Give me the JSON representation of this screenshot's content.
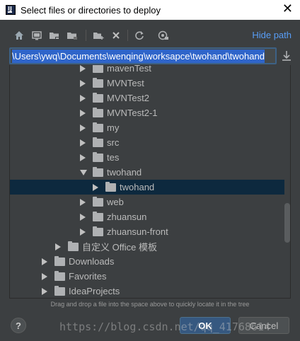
{
  "window": {
    "title": "Select files or directories to deploy",
    "app_icon_letter": "IJ"
  },
  "toolbar": {
    "icons": [
      "home-icon",
      "desktop-icon",
      "project-folder-icon",
      "module-folder-icon",
      "new-folder-icon",
      "delete-icon",
      "refresh-icon",
      "show-hidden-icon"
    ],
    "hide_path_label": "Hide path"
  },
  "path": {
    "value": "\\Users\\ywq\\Documents\\wenqing\\worksapce\\twohand\\twohand"
  },
  "tree": {
    "items": [
      {
        "label": "mavenTest",
        "expanded": false,
        "indent": 2
      },
      {
        "label": "MVNTest",
        "expanded": false,
        "indent": 2
      },
      {
        "label": "MVNTest2",
        "expanded": false,
        "indent": 2
      },
      {
        "label": "MVNTest2-1",
        "expanded": false,
        "indent": 2
      },
      {
        "label": "my",
        "expanded": false,
        "indent": 2
      },
      {
        "label": "src",
        "expanded": false,
        "indent": 2
      },
      {
        "label": "tes",
        "expanded": false,
        "indent": 2
      },
      {
        "label": "twohand",
        "expanded": true,
        "indent": 2
      },
      {
        "label": "twohand",
        "expanded": false,
        "indent": 3,
        "selected": true
      },
      {
        "label": "web",
        "expanded": false,
        "indent": 2
      },
      {
        "label": "zhuansun",
        "expanded": false,
        "indent": 2
      },
      {
        "label": "zhuansun-front",
        "expanded": false,
        "indent": 2
      },
      {
        "label": "自定义 Office 模板",
        "expanded": false,
        "indent": 1
      },
      {
        "label": "Downloads",
        "expanded": false,
        "indent": 0
      },
      {
        "label": "Favorites",
        "expanded": false,
        "indent": 0
      },
      {
        "label": "IdeaProjects",
        "expanded": false,
        "indent": 0
      }
    ]
  },
  "hint": "Drag and drop a file into the space above to quickly locate it in the tree",
  "buttons": {
    "help": "?",
    "ok": "OK",
    "cancel": "Cancel"
  },
  "watermark": "https://blog.csdn.net/qq_41768614",
  "colors": {
    "background": "#3c3f41",
    "selection": "#0d293e",
    "link": "#589df6",
    "path_selection": "#2f65ca",
    "ok_button": "#365880"
  }
}
